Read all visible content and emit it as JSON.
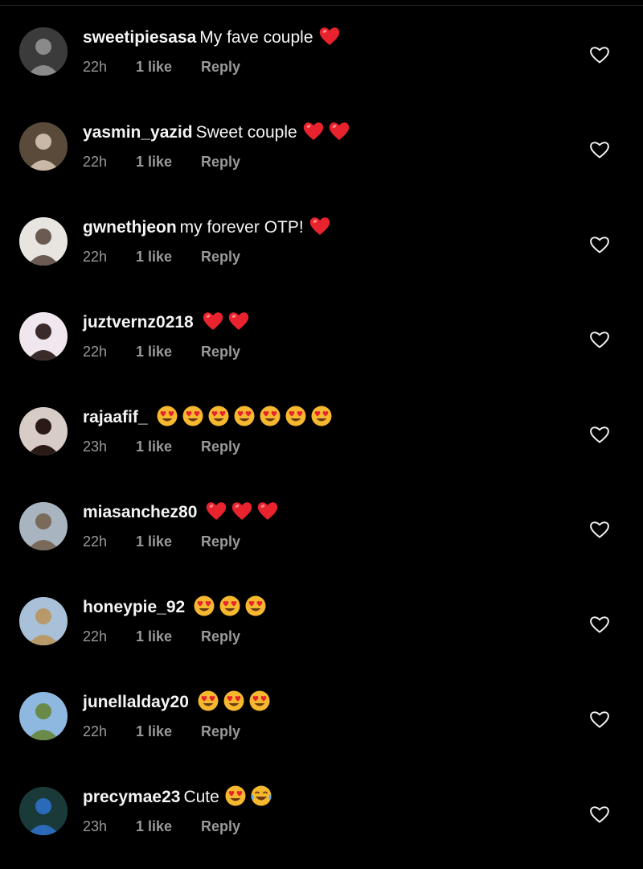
{
  "comments": [
    {
      "username": "sweetipiesasa",
      "text": "My fave couple",
      "emojis": [
        "red-heart"
      ],
      "time": "22h",
      "likes": "1 like",
      "reply": "Reply",
      "avatar_colors": [
        "#3b3b3b",
        "#8a8a8a"
      ]
    },
    {
      "username": "yasmin_yazid",
      "text": "Sweet couple",
      "emojis": [
        "red-heart",
        "red-heart"
      ],
      "time": "22h",
      "likes": "1 like",
      "reply": "Reply",
      "avatar_colors": [
        "#5a4a3a",
        "#c9b8a6"
      ]
    },
    {
      "username": "gwnethjeon",
      "text": "my forever OTP!",
      "emojis": [
        "red-heart"
      ],
      "time": "22h",
      "likes": "1 like",
      "reply": "Reply",
      "avatar_colors": [
        "#e8e4e0",
        "#6a5a52"
      ]
    },
    {
      "username": "juztvernz0218",
      "text": "",
      "emojis": [
        "red-heart",
        "red-heart"
      ],
      "time": "22h",
      "likes": "1 like",
      "reply": "Reply",
      "avatar_colors": [
        "#f0e6ee",
        "#3a2a2a"
      ]
    },
    {
      "username": "rajaafif_",
      "text": "",
      "emojis": [
        "heart-eyes",
        "heart-eyes",
        "heart-eyes",
        "heart-eyes",
        "heart-eyes",
        "heart-eyes",
        "heart-eyes"
      ],
      "time": "23h",
      "likes": "1 like",
      "reply": "Reply",
      "avatar_colors": [
        "#d8ccc6",
        "#2a1a16"
      ]
    },
    {
      "username": "miasanchez80",
      "text": "",
      "emojis": [
        "red-heart",
        "red-heart",
        "red-heart"
      ],
      "time": "22h",
      "likes": "1 like",
      "reply": "Reply",
      "avatar_colors": [
        "#a8b4c0",
        "#7a6a5a"
      ]
    },
    {
      "username": "honeypie_92",
      "text": "",
      "emojis": [
        "heart-eyes",
        "heart-eyes",
        "heart-eyes"
      ],
      "time": "22h",
      "likes": "1 like",
      "reply": "Reply",
      "avatar_colors": [
        "#a8c0d8",
        "#b89a6a"
      ]
    },
    {
      "username": "junellalday20",
      "text": "",
      "emojis": [
        "heart-eyes",
        "heart-eyes",
        "heart-eyes"
      ],
      "time": "22h",
      "likes": "1 like",
      "reply": "Reply",
      "avatar_colors": [
        "#8fb8e0",
        "#6a8a4a"
      ]
    },
    {
      "username": "precymae23",
      "text": "Cute",
      "emojis": [
        "heart-eyes",
        "tears-of-joy"
      ],
      "time": "23h",
      "likes": "1 like",
      "reply": "Reply",
      "avatar_colors": [
        "#1a3a3a",
        "#2a6ab8"
      ]
    }
  ],
  "colors": {
    "background": "#000000",
    "primary_text": "#f5f5f5",
    "secondary_text": "#9a9a9a",
    "heart_red": "#e8232e",
    "emoji_yellow": "#f5b82e"
  },
  "icons": {
    "like_button": "heart-outline-icon"
  }
}
